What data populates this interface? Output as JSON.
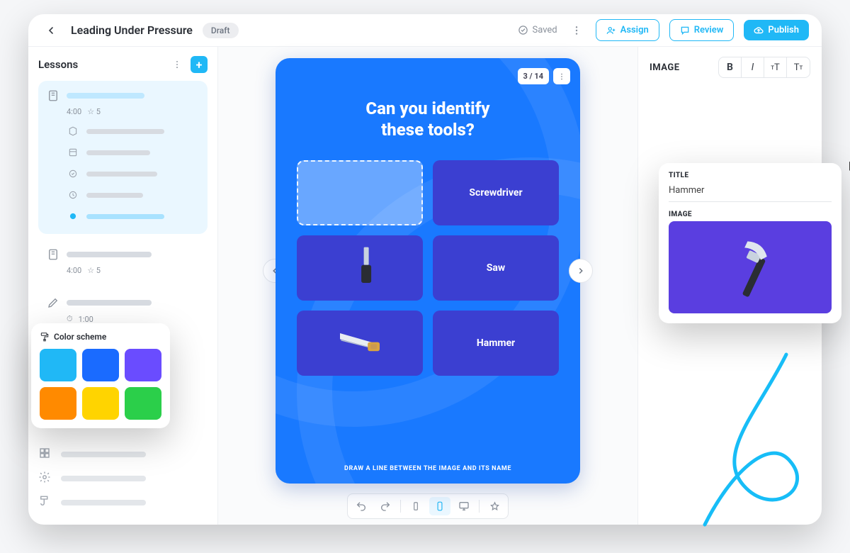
{
  "header": {
    "title": "Leading Under Pressure",
    "status_pill": "Draft",
    "saved_label": "Saved",
    "assign_label": "Assign",
    "review_label": "Review",
    "publish_label": "Publish"
  },
  "sidebar": {
    "title": "Lessons",
    "lessons": [
      {
        "duration": "4:00",
        "rating": "☆ 5",
        "active": true
      },
      {
        "duration": "4:00",
        "rating": "☆ 5"
      },
      {
        "duration": "1:00",
        "clock": true
      }
    ]
  },
  "slide": {
    "page_indicator": "3 / 14",
    "title_line1": "Can you identify",
    "title_line2": "these tools?",
    "right_labels": [
      "Screwdriver",
      "Saw",
      "Hammer"
    ],
    "hint": "DRAW A LINE BETWEEN THE IMAGE AND ITS NAME"
  },
  "rightpane": {
    "section_label": "IMAGE",
    "title_field_label": "TITLE",
    "title_value": "Hammer",
    "image_field_label": "IMAGE"
  },
  "color_scheme": {
    "label": "Color scheme",
    "swatches": [
      "#20b8f6",
      "#1a6bff",
      "#6a4cff",
      "#ff8a00",
      "#ffd400",
      "#2bcf4a"
    ]
  }
}
